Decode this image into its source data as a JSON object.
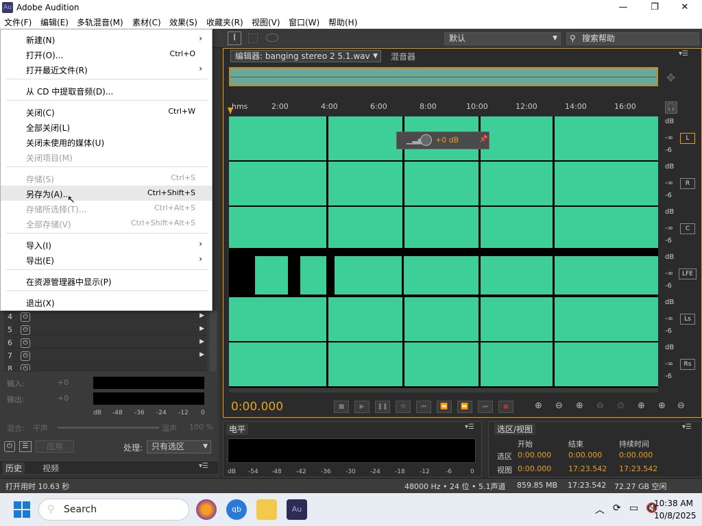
{
  "window": {
    "title": "Adobe Audition",
    "logo_text": "Au",
    "minimize": "—",
    "maximize": "❐",
    "close": "✕"
  },
  "menubar": [
    "文件(F)",
    "编辑(E)",
    "多轨混音(M)",
    "素材(C)",
    "效果(S)",
    "收藏夹(R)",
    "视图(V)",
    "窗口(W)",
    "帮助(H)"
  ],
  "file_menu": [
    {
      "label": "新建(N)",
      "shortcut": "",
      "submenu": true,
      "disabled": false
    },
    {
      "label": "打开(O)...",
      "shortcut": "Ctrl+O",
      "submenu": false,
      "disabled": false
    },
    {
      "label": "打开最近文件(R)",
      "shortcut": "",
      "submenu": true,
      "disabled": false
    },
    {
      "label": "从 CD 中提取音频(D)...",
      "shortcut": "",
      "submenu": false,
      "disabled": false
    },
    {
      "label": "关闭(C)",
      "shortcut": "Ctrl+W",
      "submenu": false,
      "disabled": false
    },
    {
      "label": "全部关闭(L)",
      "shortcut": "",
      "submenu": false,
      "disabled": false
    },
    {
      "label": "关闭未使用的媒体(U)",
      "shortcut": "",
      "submenu": false,
      "disabled": false
    },
    {
      "label": "关闭项目(M)",
      "shortcut": "",
      "submenu": false,
      "disabled": true
    },
    {
      "label": "存储(S)",
      "shortcut": "Ctrl+S",
      "submenu": false,
      "disabled": true
    },
    {
      "label": "另存为(A)...",
      "shortcut": "Ctrl+Shift+S",
      "submenu": false,
      "disabled": false,
      "highlighted": true
    },
    {
      "label": "存储所选择(T)...",
      "shortcut": "Ctrl+Alt+S",
      "submenu": false,
      "disabled": true
    },
    {
      "label": "全部存储(V)",
      "shortcut": "Ctrl+Shift+Alt+S",
      "submenu": false,
      "disabled": true
    },
    {
      "label": "导入(I)",
      "shortcut": "",
      "submenu": true,
      "disabled": false
    },
    {
      "label": "导出(E)",
      "shortcut": "",
      "submenu": true,
      "disabled": false
    },
    {
      "label": "在资源管理器中显示(P)",
      "shortcut": "",
      "submenu": false,
      "disabled": false
    },
    {
      "label": "退出(X)",
      "shortcut": "",
      "submenu": false,
      "disabled": false
    }
  ],
  "toolbar": {
    "workspace": "默认",
    "search_placeholder": "搜索帮助"
  },
  "editor": {
    "tab_label": "编辑器: banging stereo 2 5.1.wav",
    "mixer_tab": "混音器",
    "ruler_labels": [
      "hms",
      "2:00",
      "4:00",
      "6:00",
      "8:00",
      "10:00",
      "12:00",
      "14:00",
      "16:00"
    ],
    "hud_value": "+0 dB",
    "channels": [
      "L",
      "R",
      "C",
      "LFE",
      "Ls",
      "Rs"
    ],
    "db_top": "dB",
    "db_inf": "-∞",
    "db_minus6": "-6",
    "timecode": "0:00.000"
  },
  "left_panel": {
    "tracks": [
      "4",
      "5",
      "6",
      "7",
      "8"
    ],
    "input_label": "输入:",
    "output_label": "输出:",
    "meter_scale": [
      "dB",
      "-48",
      "-36",
      "-24",
      "-12",
      "0"
    ],
    "mix_label": "混合:",
    "dry": "干声",
    "wet": "湿声",
    "wet_value": "100 %",
    "apply": "应用",
    "process_label": "处理:",
    "process_value": "只有选区",
    "db_plus": "+0"
  },
  "bottom_tabs": {
    "history": "历史",
    "video": "视频",
    "levels": "电平",
    "selview": "选区/视图"
  },
  "levels_scale": [
    "dB",
    "-54",
    "-48",
    "-42",
    "-36",
    "-30",
    "-24",
    "-18",
    "-12",
    "-6",
    "0"
  ],
  "selection": {
    "headers": [
      "开始",
      "结束",
      "持续时间"
    ],
    "rows": [
      {
        "label": "选区",
        "start": "0:00.000",
        "end": "0:00.000",
        "duration": "0:00.000"
      },
      {
        "label": "视图",
        "start": "0:00.000",
        "end": "17:23.542",
        "duration": "17:23.542"
      }
    ]
  },
  "status": {
    "open_time": "打开用时 10.63 秒",
    "format": "48000 Hz • 24 位 • 5.1声道",
    "size": "859.85 MB",
    "duration": "17:23.542",
    "free": "72.27 GB 空闲"
  },
  "taskbar": {
    "search": "Search",
    "clock_time": "10:38 AM",
    "clock_date": "10/8/2025",
    "qb": "qb",
    "au": "Au"
  }
}
